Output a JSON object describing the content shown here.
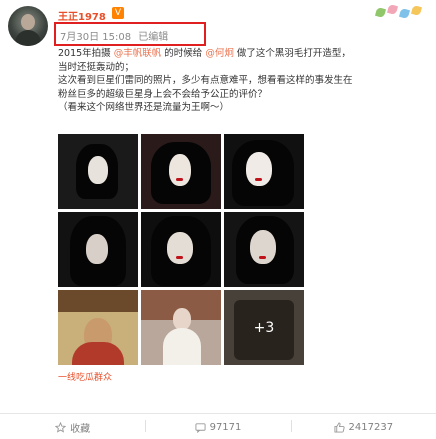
{
  "user": {
    "name": "王正1978",
    "badge": "V"
  },
  "post": {
    "timestamp": "7月30日 15:08",
    "edited": "已编辑",
    "lines": [
      "2015年拍摄",
      "的时候给",
      "做了这个黑羽毛打开造型，",
      "当时还挺轰动的；",
      "这次看到巨星们雷同的照片，多少有点意难平，想看看这样的事发生在",
      "粉丝巨多的超级巨星身上会不会给予公正的评价？",
      "（看来这个网络世界还是流量为王啊～）"
    ],
    "mention_1": "@丰帆联帆",
    "mention_2": "@何炯",
    "more_count": "+3",
    "tail": "一线吃瓜群众"
  },
  "actions": [
    {
      "label": "收藏"
    },
    {
      "label": "97171"
    },
    {
      "label": "2417237"
    }
  ],
  "colors": {
    "name": "#e8502b",
    "highlight": "#e02020",
    "text": "#333333",
    "meta": "#8a8a8a"
  }
}
